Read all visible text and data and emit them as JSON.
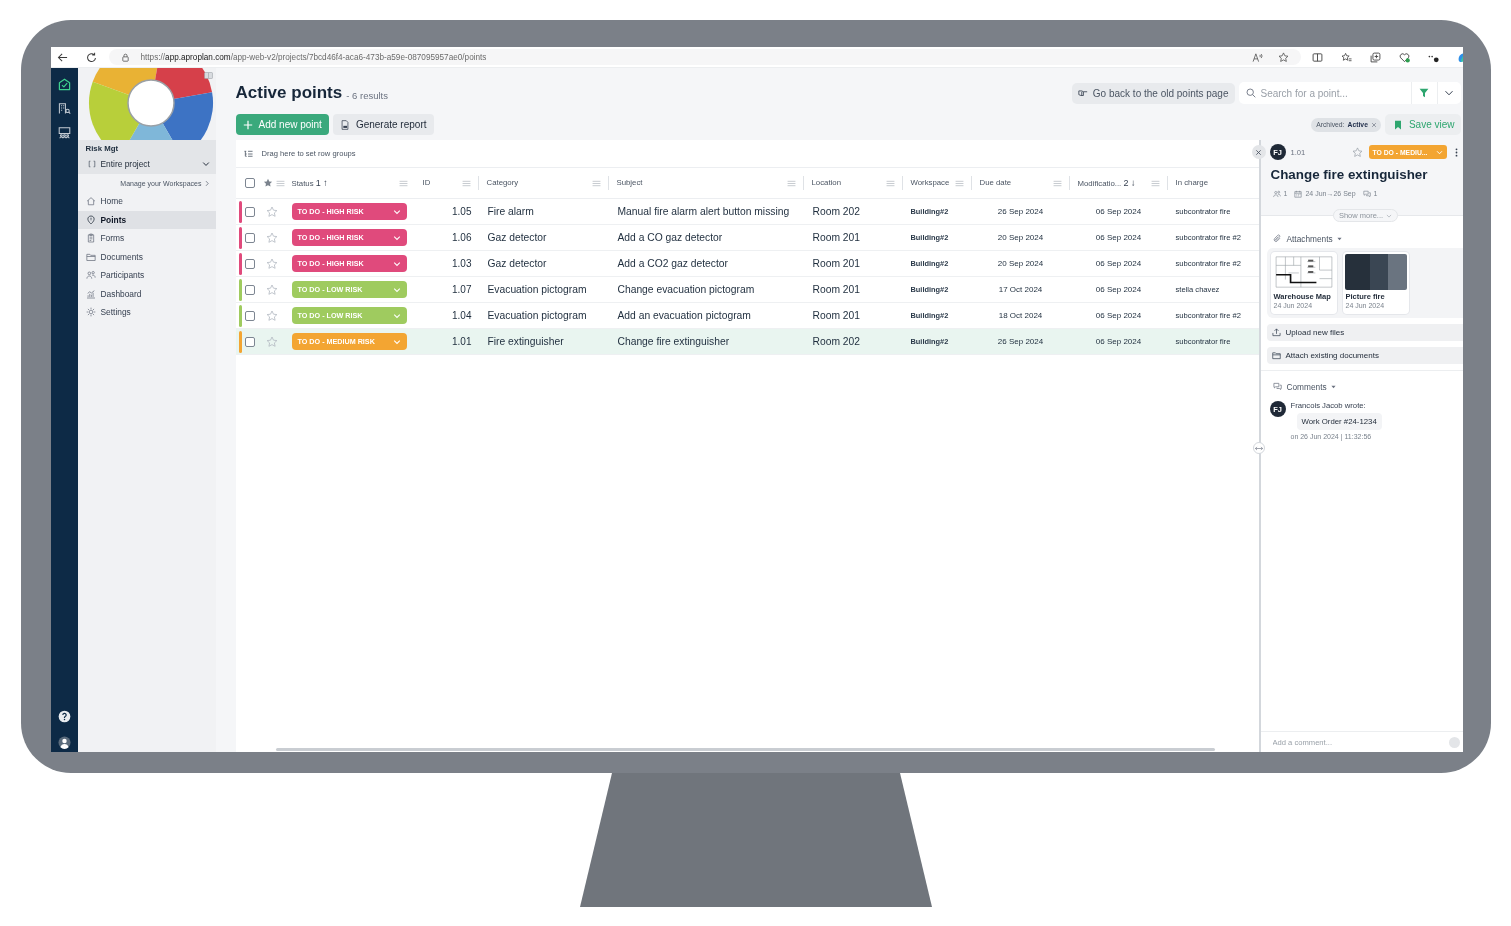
{
  "browser": {
    "url_scheme": "https://",
    "url_host": "app.aproplan.com",
    "url_path": "/app-web-v2/projects/7bcd46f4-aca6-473b-a59e-087095957ae0/points"
  },
  "rail": {
    "items": [
      {
        "kind": "points",
        "selected": true
      },
      {
        "kind": "buildings",
        "selected": false
      },
      {
        "kind": "meetings",
        "selected": false
      }
    ]
  },
  "sidebar": {
    "project": "Risk Mgt",
    "scope": "Entire project",
    "manage_link": "Manage your Workspaces",
    "items": [
      {
        "kind": "home",
        "label": "Home",
        "selected": false
      },
      {
        "kind": "points",
        "label": "Points",
        "selected": true
      },
      {
        "kind": "forms",
        "label": "Forms",
        "selected": false
      },
      {
        "kind": "documents",
        "label": "Documents",
        "selected": false
      },
      {
        "kind": "participants",
        "label": "Participants",
        "selected": false
      },
      {
        "kind": "dashboard",
        "label": "Dashboard",
        "selected": false
      },
      {
        "kind": "settings",
        "label": "Settings",
        "selected": false
      }
    ]
  },
  "header": {
    "title": "Active points",
    "results": "- 6 results",
    "actions": [
      {
        "kind": "primary",
        "label": "Add new point"
      },
      {
        "kind": "secondary",
        "label": "Generate report"
      }
    ],
    "old_page_button": "Go back to the old points page",
    "search": {
      "placeholder": "Search for a point..."
    },
    "filters": [
      {
        "label": "Archived:",
        "value": "Active"
      }
    ],
    "save_view": "Save view"
  },
  "table": {
    "group_hint": "Drag here to set row groups",
    "all_checked": false,
    "columns": [
      {
        "label": "Status",
        "sort_order": "1",
        "sort_arrow": "↑"
      },
      {
        "label": "ID"
      },
      {
        "label": "Category"
      },
      {
        "label": "Subject"
      },
      {
        "label": "Location"
      },
      {
        "label": "Workspace"
      },
      {
        "label": "Due date"
      },
      {
        "label": "Modificatio...",
        "sort_order": "2",
        "sort_arrow": "↓"
      },
      {
        "label": "In charge"
      }
    ],
    "rows": [
      {
        "checked": false,
        "starred": false,
        "selected": false,
        "status": "TO DO - HIGH RISK",
        "color": "#e04a7c",
        "id": "1.05",
        "category": "Fire alarm",
        "subject": "Manual fire alarm alert button missing",
        "location": "Room 202",
        "workspace": "Building#2",
        "due_date": "26 Sep 2024",
        "modified": "06 Sep 2024",
        "in_charge": "subcontrator fire"
      },
      {
        "checked": false,
        "starred": false,
        "selected": false,
        "status": "TO DO - HIGH RISK",
        "color": "#e04a7c",
        "id": "1.06",
        "category": "Gaz detector",
        "subject": "Add a CO gaz detector",
        "location": "Room 201",
        "workspace": "Building#2",
        "due_date": "20 Sep 2024",
        "modified": "06 Sep 2024",
        "in_charge": "subcontrator fire #2"
      },
      {
        "checked": false,
        "starred": false,
        "selected": false,
        "status": "TO DO - HIGH RISK",
        "color": "#e04a7c",
        "id": "1.03",
        "category": "Gaz detector",
        "subject": "Add a CO2 gaz detector",
        "location": "Room 201",
        "workspace": "Building#2",
        "due_date": "20 Sep 2024",
        "modified": "06 Sep 2024",
        "in_charge": "subcontrator fire #2"
      },
      {
        "checked": false,
        "starred": false,
        "selected": false,
        "status": "TO DO - LOW RISK",
        "color": "#9fcb5f",
        "id": "1.07",
        "category": "Evacuation pictogram",
        "subject": "Change evacuation pictogram",
        "location": "Room 201",
        "workspace": "Building#2",
        "due_date": "17 Oct 2024",
        "modified": "06 Sep 2024",
        "in_charge": "stella chavez"
      },
      {
        "checked": false,
        "starred": false,
        "selected": false,
        "status": "TO DO - LOW RISK",
        "color": "#9fcb5f",
        "id": "1.04",
        "category": "Evacuation pictogram",
        "subject": "Add an evacuation pictogram",
        "location": "Room 201",
        "workspace": "Building#2",
        "due_date": "18 Oct 2024",
        "modified": "06 Sep 2024",
        "in_charge": "subcontrator fire #2"
      },
      {
        "checked": false,
        "starred": false,
        "selected": true,
        "status": "TO DO - MEDIUM RISK",
        "color": "#f3a532",
        "id": "1.01",
        "category": "Fire extinguisher",
        "subject": "Change fire extinguisher",
        "location": "Room 202",
        "workspace": "Building#2",
        "due_date": "26 Sep 2024",
        "modified": "06 Sep 2024",
        "in_charge": "subcontrator fire"
      }
    ]
  },
  "panel": {
    "avatar": "FJ",
    "id": "1.01",
    "starred": false,
    "status": "TO DO - MEDIU...",
    "color": "#f3a532",
    "title": "Change fire extinguisher",
    "meta": [
      {
        "kind": "participants",
        "text": "1"
      },
      {
        "kind": "dates",
        "text": "24 Jun→26 Sep"
      },
      {
        "kind": "comments",
        "text": "1"
      }
    ],
    "show_more": "Show more...",
    "attachments": {
      "label": "Attachments",
      "files": [
        {
          "kind": "plan",
          "name": "Warehouse Map",
          "date": "24 Jun 2024"
        },
        {
          "kind": "photo",
          "name": "Picture fire",
          "date": "24 Jun 2024"
        }
      ]
    },
    "file_actions": [
      {
        "kind": "upload",
        "label": "Upload new files"
      },
      {
        "kind": "attach",
        "label": "Attach existing documents"
      }
    ],
    "comments": {
      "label": "Comments",
      "items": [
        {
          "avatar": "FJ",
          "author": "Francois Jacob wrote:",
          "text": "Work Order #24-1234",
          "time": "on 26 Jun 2024 | 11:32:56"
        }
      ]
    },
    "comment_field": {
      "placeholder": "Add a comment..."
    }
  }
}
